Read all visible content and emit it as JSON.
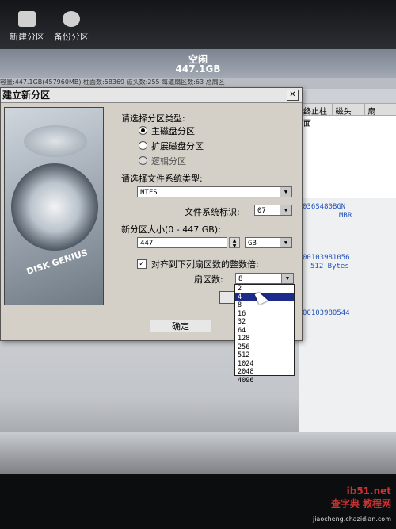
{
  "toolbar": {
    "new_partition_label": "新建分区",
    "backup_partition_label": "备份分区"
  },
  "disk": {
    "free_label": "空闲",
    "free_size": "447.1GB"
  },
  "infobar_text": "容量:447.1GB(457960MB)  柱面数:58369  磁头数:255  每道扇区数:63  总扇区",
  "bg_table": {
    "headers": [
      "终止柱面",
      "磁头",
      "扇"
    ],
    "text_1": "036S480BGN",
    "text_2": "MBR",
    "text_3": "00103981056",
    "text_4": "512 Bytes",
    "text_5": "00103980544"
  },
  "dialog": {
    "title": "建立新分区",
    "partition_type_label": "请选择分区类型:",
    "partition_types": [
      "主磁盘分区",
      "扩展磁盘分区",
      "逻辑分区"
    ],
    "fs_type_label": "请选择文件系统类型:",
    "fs_type_value": "NTFS",
    "fs_id_label": "文件系统标识:",
    "fs_id_value": "07",
    "size_label": "新分区大小(0 - 447 GB):",
    "size_value": "447",
    "size_unit": "GB",
    "align_label": "对齐到下列扇区数的整数倍:",
    "sector_count_label": "扇区数:",
    "sector_count_value": "8",
    "ok_label": "确定",
    "brand_text": "DISK GENIUS"
  },
  "sector_options": [
    "2",
    "4",
    "8",
    "16",
    "32",
    "64",
    "128",
    "256",
    "512",
    "1024",
    "2048",
    "4096"
  ],
  "selected_option_index": 1,
  "watermark": {
    "site": "查字典 教程网",
    "url": "jiaocheng.chazidian.com",
    "tag": "ib51.net"
  }
}
